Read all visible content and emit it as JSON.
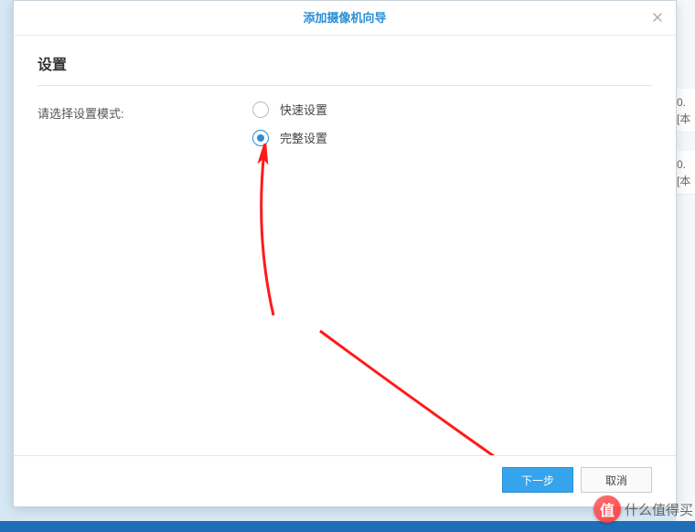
{
  "dialog": {
    "title": "添加摄像机向导",
    "section_title": "设置",
    "form_label": "请选择设置模式:",
    "options": {
      "quick": "快速设置",
      "full": "完整设置"
    },
    "selected_option": "full",
    "buttons": {
      "next": "下一步",
      "cancel": "取消"
    }
  },
  "background": {
    "row1_val": "0.",
    "row1_loc": "[本",
    "row2_val": "0.",
    "row2_loc": "[本"
  },
  "watermark": {
    "icon_text": "值",
    "text": "什么值得买"
  }
}
